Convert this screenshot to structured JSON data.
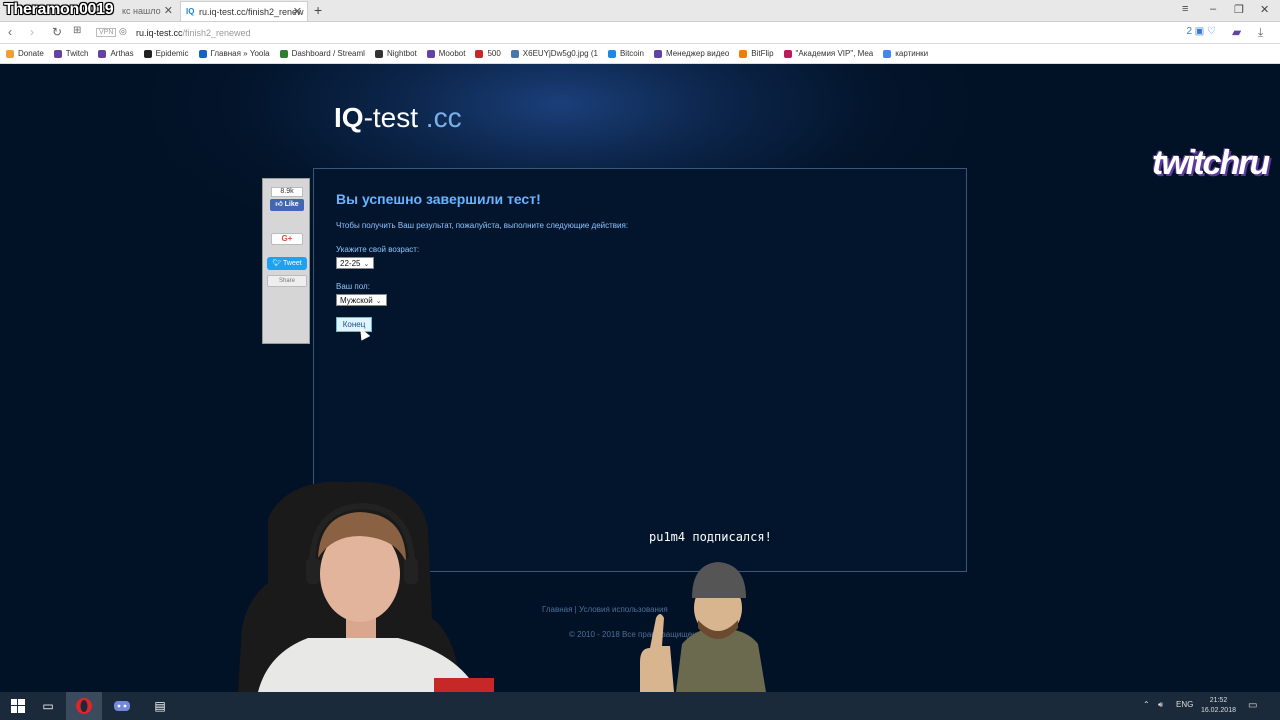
{
  "browser": {
    "streamer_overlay": "Theramon0019",
    "tabs": [
      {
        "label": "кс нашло",
        "active": false
      },
      {
        "label": "ru.iq-test.cc/finish2_renew",
        "active": true
      }
    ],
    "address": {
      "vpn": "VPN",
      "url_host": "ru.iq-test.cc",
      "url_path": "/finish2_renewed",
      "badge_count": "2"
    },
    "bookmarks": [
      {
        "label": "Donate",
        "color": "#f0a030"
      },
      {
        "label": "Twitch",
        "color": "#6441a4"
      },
      {
        "label": "Arthas",
        "color": "#6441a4"
      },
      {
        "label": "Epidemic",
        "color": "#222222"
      },
      {
        "label": "Главная » Yoola",
        "color": "#1565c0"
      },
      {
        "label": "Dashboard / Streaml",
        "color": "#2e7d32"
      },
      {
        "label": "Nightbot",
        "color": "#333333"
      },
      {
        "label": "Moobot",
        "color": "#6441a4"
      },
      {
        "label": "500",
        "color": "#c62828"
      },
      {
        "label": "X6EUYjDw5g0.jpg (1",
        "color": "#4a76a8"
      },
      {
        "label": "Bitcoin",
        "color": "#1e88e5"
      },
      {
        "label": "Менеджер видео",
        "color": "#6441a4"
      },
      {
        "label": "BitFlip",
        "color": "#f57c00"
      },
      {
        "label": "\"Академия VIP\", Mea",
        "color": "#c2185b"
      },
      {
        "label": "картинки",
        "color": "#4285f4"
      }
    ]
  },
  "site": {
    "logo_bold": "IQ",
    "logo_rest": "-test",
    "logo_tld": " .cc",
    "twitch_watermark": "twitchru"
  },
  "social": {
    "fb_count": "8.9k",
    "fb_like": "Like",
    "gplus": "G+",
    "tweet": "Tweet",
    "share": "Share"
  },
  "form": {
    "title": "Вы успешно завершили тест!",
    "subtitle": "Чтобы получить Ваш результат, пожалуйста, выполните следующие действия:",
    "age_label": "Укажите свой возраст:",
    "age_value": "22-25",
    "gender_label": "Ваш пол:",
    "gender_value": "Мужской",
    "submit_label": "Конец"
  },
  "stream_alert": "pu1m4 подписался!",
  "footer": {
    "links": "Главная | Условия использования",
    "copyright": "© 2010 - 2018 Все права защищены"
  },
  "taskbar": {
    "lang": "ENG",
    "time": "21:52",
    "date": "16.02.2018"
  },
  "colors": {
    "page_bg": "#021226",
    "accent": "#6ab3ff",
    "button_bg": "#e0f5ff"
  }
}
